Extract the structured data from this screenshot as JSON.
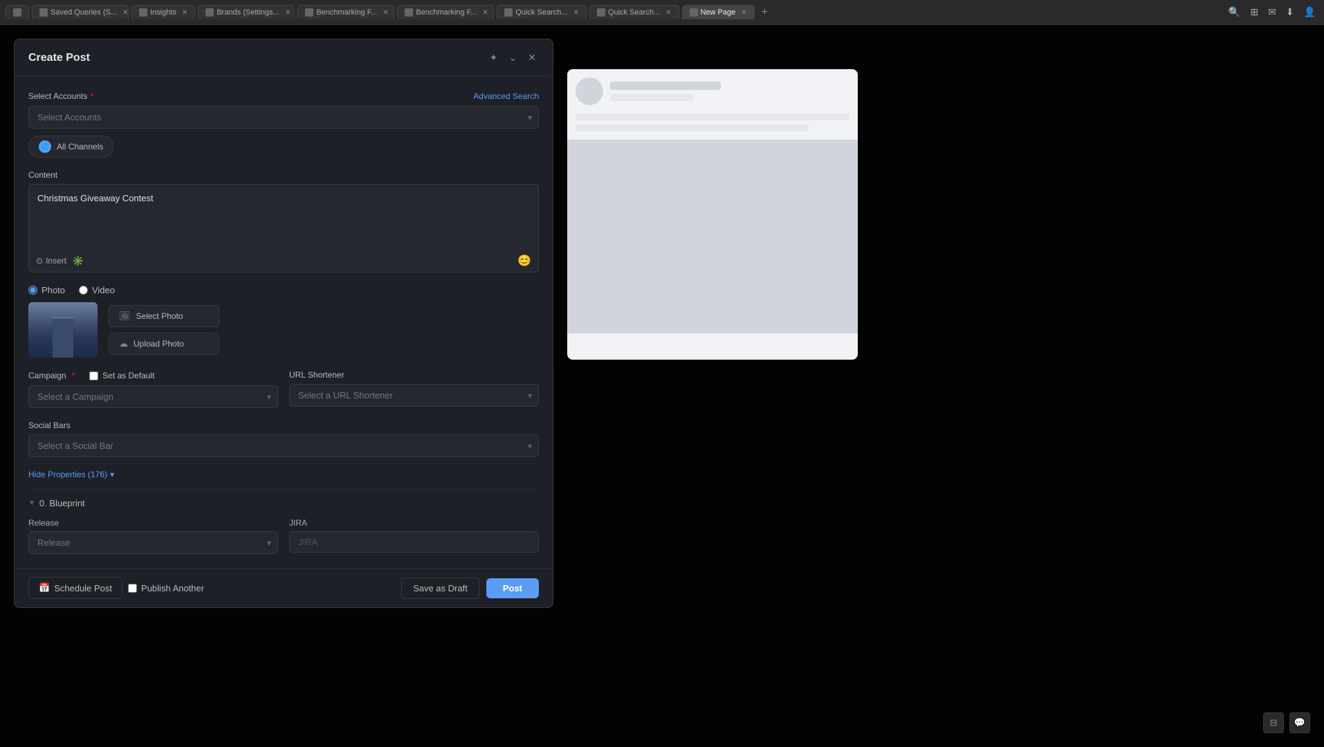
{
  "browser": {
    "tabs": [
      {
        "label": "Saved Queries (S...",
        "active": false
      },
      {
        "label": "Insights",
        "active": false
      },
      {
        "label": "Brands (Settings...",
        "active": false
      },
      {
        "label": "Benchmarking F...",
        "active": false
      },
      {
        "label": "Benchmarking F...",
        "active": false
      },
      {
        "label": "Quick Search...",
        "active": false
      },
      {
        "label": "Quick Search...",
        "active": false
      },
      {
        "label": "New Page",
        "active": true
      }
    ],
    "new_tab_label": "+",
    "icons": [
      "🔍",
      "⊞",
      "✉",
      "⬇",
      "👤"
    ]
  },
  "modal": {
    "title": "Create Post",
    "header_actions": {
      "expand_label": "✦",
      "minimize_label": "⌄",
      "close_label": "✕"
    }
  },
  "form": {
    "select_accounts_label": "Select Accounts",
    "select_accounts_placeholder": "Select Accounts",
    "advanced_search_label": "Advanced Search",
    "all_channels_label": "All Channels",
    "content_label": "Content",
    "content_value": "Christmas Giveaway Contest",
    "insert_label": "Insert",
    "photo_label": "Photo",
    "video_label": "Video",
    "select_photo_label": "Select Photo",
    "upload_photo_label": "Upload Photo",
    "campaign_label": "Campaign",
    "set_as_default_label": "Set as Default",
    "url_shortener_label": "URL Shortener",
    "select_campaign_placeholder": "Select a Campaign",
    "select_url_shortener_placeholder": "Select a URL Shortener",
    "social_bars_label": "Social Bars",
    "select_social_bar_placeholder": "Select a Social Bar",
    "hide_properties_label": "Hide Properties (176)",
    "blueprint_label": "0. Blueprint",
    "release_label": "Release",
    "release_placeholder": "Release",
    "jira_label": "JIRA",
    "jira_placeholder": "JIRA",
    "schedule_post_label": "Schedule Post",
    "publish_another_label": "Publish Another",
    "save_as_draft_label": "Save as Draft",
    "post_label": "Post"
  }
}
